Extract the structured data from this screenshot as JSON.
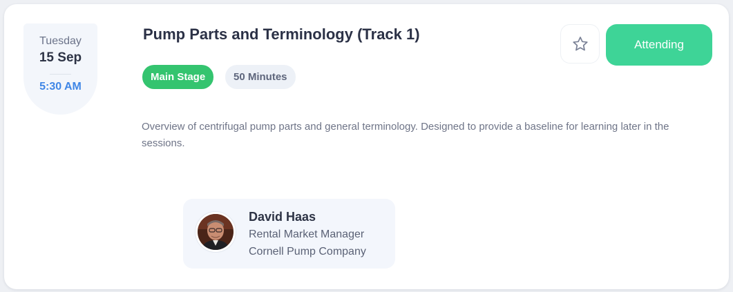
{
  "session": {
    "date": {
      "weekday": "Tuesday",
      "day": "15 Sep",
      "time": "5:30 AM"
    },
    "title": "Pump Parts and Terminology (Track 1)",
    "tags": {
      "stage": "Main Stage",
      "duration": "50 Minutes"
    },
    "actions": {
      "favorite_icon": "star-outline-icon",
      "attend_label": "Attending"
    },
    "description": "Overview of centrifugal pump parts and general terminology. Designed to provide a baseline for learning later in the sessions.",
    "speaker": {
      "name": "David Haas",
      "role": "Rental Market Manager",
      "company": "Cornell Pump Company"
    }
  },
  "colors": {
    "stage_tag": "#34c46f",
    "attend_button": "#3ed497",
    "time_accent": "#3f86e6",
    "title_text": "#2b3146"
  }
}
